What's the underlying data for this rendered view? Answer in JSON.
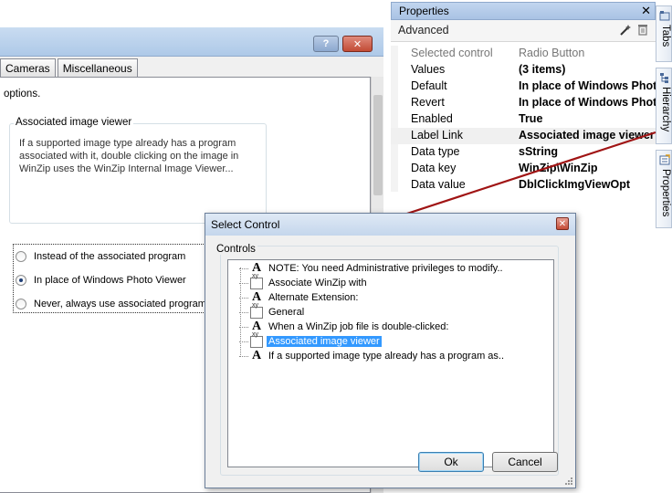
{
  "bg_dialog": {
    "help_label": "?",
    "close_label": "✕",
    "tabs": [
      "Cameras",
      "Miscellaneous"
    ],
    "options_text": "options.",
    "group_label": "Associated image viewer",
    "group_desc": "If a supported image type already has a program associated with it, double clicking on the image in WinZip uses the WinZip Internal Image Viewer...",
    "radios": [
      {
        "label": "Instead of the associated program",
        "checked": false
      },
      {
        "label": "In place of Windows Photo Viewer",
        "checked": true
      },
      {
        "label": "Never, always use associated program",
        "checked": false
      }
    ]
  },
  "properties": {
    "title": "Properties",
    "close_label": "✕",
    "category": "Advanced",
    "header": {
      "name": "Selected control",
      "value": "Radio Button"
    },
    "rows": [
      {
        "name": "Values",
        "value": "(3 items)"
      },
      {
        "name": "Default",
        "value": "In place of Windows Photo Viewer"
      },
      {
        "name": "Revert",
        "value": "In place of Windows Photo Viewer"
      },
      {
        "name": "Enabled",
        "value": "True"
      },
      {
        "name": "Label Link",
        "value": "Associated image viewer"
      },
      {
        "name": "Data type",
        "value": "sString"
      },
      {
        "name": "Data key",
        "value": "WinZip\\WinZip"
      },
      {
        "name": "Data value",
        "value": "DblClickImgViewOpt"
      }
    ]
  },
  "side_tabs": [
    "Tabs",
    "Hierarchy",
    "Properties"
  ],
  "select_control": {
    "title": "Select Control",
    "close_label": "✕",
    "group_label": "Controls",
    "items": [
      {
        "icon": "a",
        "label": "NOTE: You need Administrative privileges to modify.."
      },
      {
        "icon": "xy",
        "label": "Associate WinZip with"
      },
      {
        "icon": "a",
        "label": "Alternate Extension:"
      },
      {
        "icon": "xy",
        "label": "General"
      },
      {
        "icon": "a",
        "label": "When a WinZip job file is double-clicked:"
      },
      {
        "icon": "xy",
        "label": "Associated image viewer",
        "selected": true
      },
      {
        "icon": "a",
        "label": "If a supported image type already has a program as.."
      }
    ],
    "ok_label": "Ok",
    "cancel_label": "Cancel"
  },
  "colors": {
    "connector": "#a01414",
    "selection": "#3399ff"
  }
}
